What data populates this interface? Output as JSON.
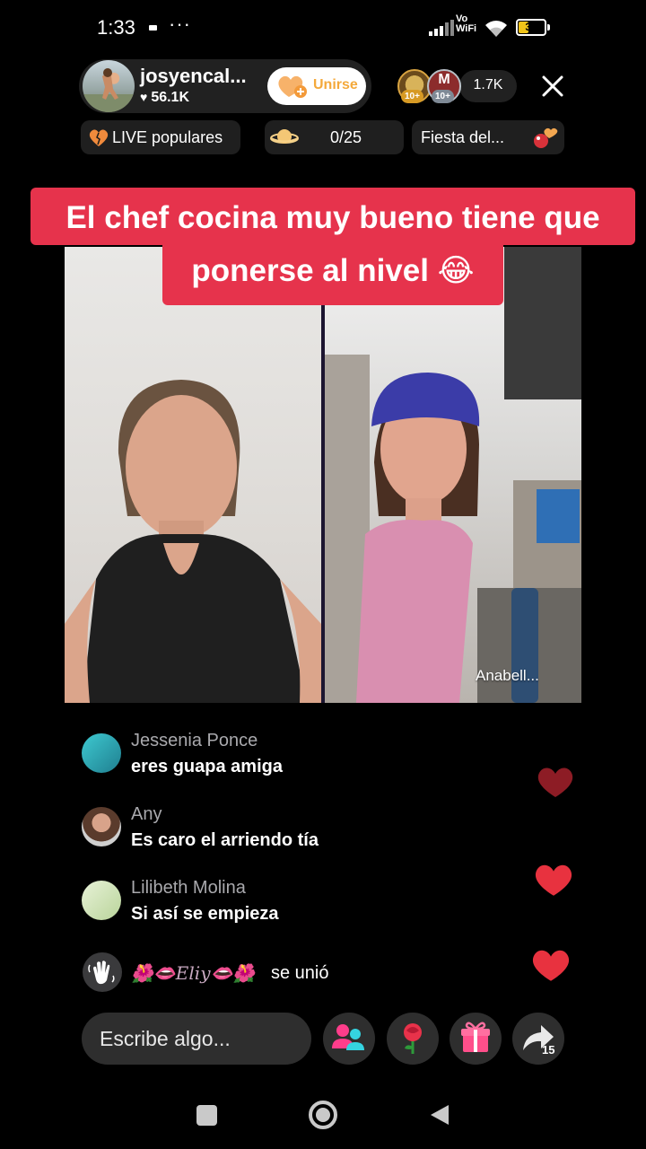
{
  "status_bar": {
    "time": "1:33",
    "more": "···",
    "network_label_top": "Vo",
    "network_label_bottom": "WiFi",
    "battery_level": "35"
  },
  "host": {
    "name": "josyencal...",
    "likes": "56.1K",
    "join_label": "Unirse"
  },
  "viewers": {
    "top_viewer_1_badge": "10+",
    "top_viewer_2_letter": "M",
    "top_viewer_2_badge": "10+",
    "count": "1.7K"
  },
  "chips": {
    "popular": "LIVE populares",
    "goal": "0/25",
    "event": "Fiesta del..."
  },
  "caption": {
    "line1": "El chef cocina muy bueno tiene que",
    "line2": "ponerse al nivel 😂"
  },
  "guest": {
    "name": "Anabell..."
  },
  "comments": [
    {
      "user": "Jessenia Ponce",
      "text": "eres guapa amiga"
    },
    {
      "user": "Any",
      "text": "Es caro el arriendo tía"
    },
    {
      "user": "Lilibeth Molina",
      "text": "Si así se empieza"
    }
  ],
  "join_event": {
    "name": "🌺👄𝐸𝑙𝑖𝑦👄🌺",
    "suffix": "se unió"
  },
  "bottom_bar": {
    "input_placeholder": "Escribe algo...",
    "share_count": "15"
  },
  "colors": {
    "caption_bg": "#e6334c",
    "join_accent": "#f4a93b",
    "heart": "#e8323f",
    "battery": "#f0c419"
  }
}
